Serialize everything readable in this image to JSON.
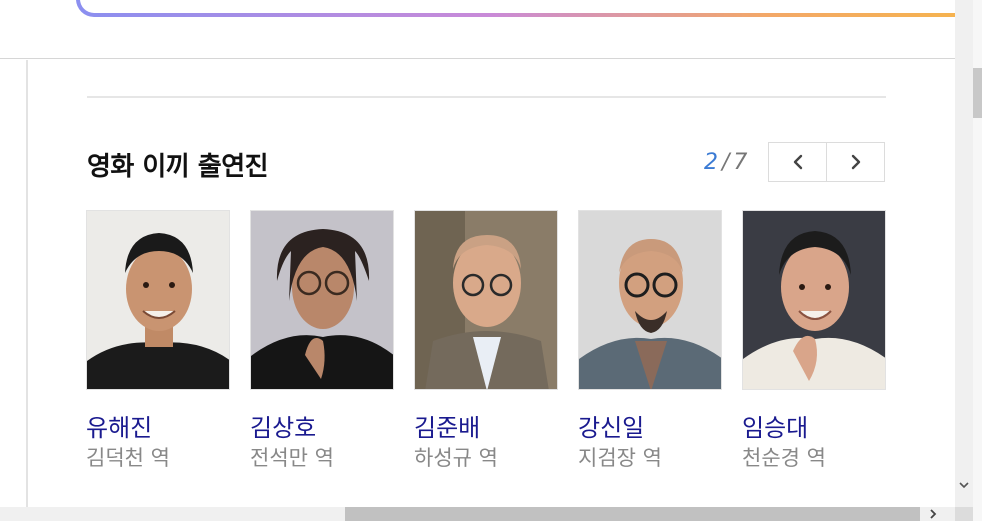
{
  "section": {
    "title": "영화 이끼 출연진"
  },
  "pager": {
    "current": "2",
    "separator": "/",
    "total": "7"
  },
  "nav": {
    "prev_icon": "chevron-left-icon",
    "next_icon": "chevron-right-icon"
  },
  "cast": [
    {
      "name": "유해진",
      "role": "김덕천 역"
    },
    {
      "name": "김상호",
      "role": "전석만 역"
    },
    {
      "name": "김준배",
      "role": "하성규 역"
    },
    {
      "name": "강신일",
      "role": "지검장 역"
    },
    {
      "name": "임승대",
      "role": "천순경 역"
    }
  ],
  "colors": {
    "cast_name": "#1a1a8f",
    "pager_current": "#3b7bd4",
    "search_gradient": [
      "#8b8ff0",
      "#c98ad8",
      "#f3a868",
      "#f6b54a"
    ]
  }
}
